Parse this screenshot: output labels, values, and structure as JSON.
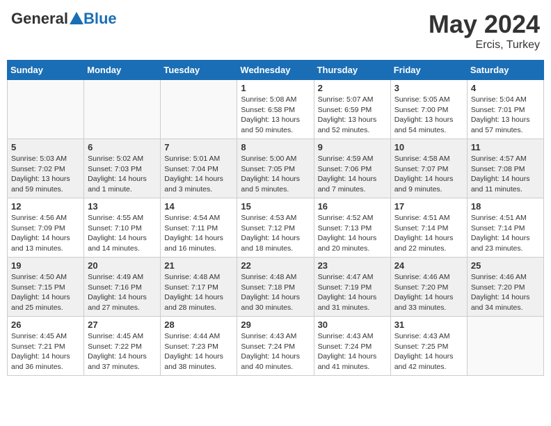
{
  "header": {
    "logo_general": "General",
    "logo_blue": "Blue",
    "month_year": "May 2024",
    "location": "Ercis, Turkey"
  },
  "days_of_week": [
    "Sunday",
    "Monday",
    "Tuesday",
    "Wednesday",
    "Thursday",
    "Friday",
    "Saturday"
  ],
  "weeks": [
    [
      {
        "day": "",
        "sunrise": "",
        "sunset": "",
        "daylight": "",
        "empty": true
      },
      {
        "day": "",
        "sunrise": "",
        "sunset": "",
        "daylight": "",
        "empty": true
      },
      {
        "day": "",
        "sunrise": "",
        "sunset": "",
        "daylight": "",
        "empty": true
      },
      {
        "day": "1",
        "sunrise": "Sunrise: 5:08 AM",
        "sunset": "Sunset: 6:58 PM",
        "daylight": "Daylight: 13 hours and 50 minutes.",
        "empty": false
      },
      {
        "day": "2",
        "sunrise": "Sunrise: 5:07 AM",
        "sunset": "Sunset: 6:59 PM",
        "daylight": "Daylight: 13 hours and 52 minutes.",
        "empty": false
      },
      {
        "day": "3",
        "sunrise": "Sunrise: 5:05 AM",
        "sunset": "Sunset: 7:00 PM",
        "daylight": "Daylight: 13 hours and 54 minutes.",
        "empty": false
      },
      {
        "day": "4",
        "sunrise": "Sunrise: 5:04 AM",
        "sunset": "Sunset: 7:01 PM",
        "daylight": "Daylight: 13 hours and 57 minutes.",
        "empty": false
      }
    ],
    [
      {
        "day": "5",
        "sunrise": "Sunrise: 5:03 AM",
        "sunset": "Sunset: 7:02 PM",
        "daylight": "Daylight: 13 hours and 59 minutes.",
        "empty": false
      },
      {
        "day": "6",
        "sunrise": "Sunrise: 5:02 AM",
        "sunset": "Sunset: 7:03 PM",
        "daylight": "Daylight: 14 hours and 1 minute.",
        "empty": false
      },
      {
        "day": "7",
        "sunrise": "Sunrise: 5:01 AM",
        "sunset": "Sunset: 7:04 PM",
        "daylight": "Daylight: 14 hours and 3 minutes.",
        "empty": false
      },
      {
        "day": "8",
        "sunrise": "Sunrise: 5:00 AM",
        "sunset": "Sunset: 7:05 PM",
        "daylight": "Daylight: 14 hours and 5 minutes.",
        "empty": false
      },
      {
        "day": "9",
        "sunrise": "Sunrise: 4:59 AM",
        "sunset": "Sunset: 7:06 PM",
        "daylight": "Daylight: 14 hours and 7 minutes.",
        "empty": false
      },
      {
        "day": "10",
        "sunrise": "Sunrise: 4:58 AM",
        "sunset": "Sunset: 7:07 PM",
        "daylight": "Daylight: 14 hours and 9 minutes.",
        "empty": false
      },
      {
        "day": "11",
        "sunrise": "Sunrise: 4:57 AM",
        "sunset": "Sunset: 7:08 PM",
        "daylight": "Daylight: 14 hours and 11 minutes.",
        "empty": false
      }
    ],
    [
      {
        "day": "12",
        "sunrise": "Sunrise: 4:56 AM",
        "sunset": "Sunset: 7:09 PM",
        "daylight": "Daylight: 14 hours and 13 minutes.",
        "empty": false
      },
      {
        "day": "13",
        "sunrise": "Sunrise: 4:55 AM",
        "sunset": "Sunset: 7:10 PM",
        "daylight": "Daylight: 14 hours and 14 minutes.",
        "empty": false
      },
      {
        "day": "14",
        "sunrise": "Sunrise: 4:54 AM",
        "sunset": "Sunset: 7:11 PM",
        "daylight": "Daylight: 14 hours and 16 minutes.",
        "empty": false
      },
      {
        "day": "15",
        "sunrise": "Sunrise: 4:53 AM",
        "sunset": "Sunset: 7:12 PM",
        "daylight": "Daylight: 14 hours and 18 minutes.",
        "empty": false
      },
      {
        "day": "16",
        "sunrise": "Sunrise: 4:52 AM",
        "sunset": "Sunset: 7:13 PM",
        "daylight": "Daylight: 14 hours and 20 minutes.",
        "empty": false
      },
      {
        "day": "17",
        "sunrise": "Sunrise: 4:51 AM",
        "sunset": "Sunset: 7:14 PM",
        "daylight": "Daylight: 14 hours and 22 minutes.",
        "empty": false
      },
      {
        "day": "18",
        "sunrise": "Sunrise: 4:51 AM",
        "sunset": "Sunset: 7:14 PM",
        "daylight": "Daylight: 14 hours and 23 minutes.",
        "empty": false
      }
    ],
    [
      {
        "day": "19",
        "sunrise": "Sunrise: 4:50 AM",
        "sunset": "Sunset: 7:15 PM",
        "daylight": "Daylight: 14 hours and 25 minutes.",
        "empty": false
      },
      {
        "day": "20",
        "sunrise": "Sunrise: 4:49 AM",
        "sunset": "Sunset: 7:16 PM",
        "daylight": "Daylight: 14 hours and 27 minutes.",
        "empty": false
      },
      {
        "day": "21",
        "sunrise": "Sunrise: 4:48 AM",
        "sunset": "Sunset: 7:17 PM",
        "daylight": "Daylight: 14 hours and 28 minutes.",
        "empty": false
      },
      {
        "day": "22",
        "sunrise": "Sunrise: 4:48 AM",
        "sunset": "Sunset: 7:18 PM",
        "daylight": "Daylight: 14 hours and 30 minutes.",
        "empty": false
      },
      {
        "day": "23",
        "sunrise": "Sunrise: 4:47 AM",
        "sunset": "Sunset: 7:19 PM",
        "daylight": "Daylight: 14 hours and 31 minutes.",
        "empty": false
      },
      {
        "day": "24",
        "sunrise": "Sunrise: 4:46 AM",
        "sunset": "Sunset: 7:20 PM",
        "daylight": "Daylight: 14 hours and 33 minutes.",
        "empty": false
      },
      {
        "day": "25",
        "sunrise": "Sunrise: 4:46 AM",
        "sunset": "Sunset: 7:20 PM",
        "daylight": "Daylight: 14 hours and 34 minutes.",
        "empty": false
      }
    ],
    [
      {
        "day": "26",
        "sunrise": "Sunrise: 4:45 AM",
        "sunset": "Sunset: 7:21 PM",
        "daylight": "Daylight: 14 hours and 36 minutes.",
        "empty": false
      },
      {
        "day": "27",
        "sunrise": "Sunrise: 4:45 AM",
        "sunset": "Sunset: 7:22 PM",
        "daylight": "Daylight: 14 hours and 37 minutes.",
        "empty": false
      },
      {
        "day": "28",
        "sunrise": "Sunrise: 4:44 AM",
        "sunset": "Sunset: 7:23 PM",
        "daylight": "Daylight: 14 hours and 38 minutes.",
        "empty": false
      },
      {
        "day": "29",
        "sunrise": "Sunrise: 4:43 AM",
        "sunset": "Sunset: 7:24 PM",
        "daylight": "Daylight: 14 hours and 40 minutes.",
        "empty": false
      },
      {
        "day": "30",
        "sunrise": "Sunrise: 4:43 AM",
        "sunset": "Sunset: 7:24 PM",
        "daylight": "Daylight: 14 hours and 41 minutes.",
        "empty": false
      },
      {
        "day": "31",
        "sunrise": "Sunrise: 4:43 AM",
        "sunset": "Sunset: 7:25 PM",
        "daylight": "Daylight: 14 hours and 42 minutes.",
        "empty": false
      },
      {
        "day": "",
        "sunrise": "",
        "sunset": "",
        "daylight": "",
        "empty": true
      }
    ]
  ]
}
